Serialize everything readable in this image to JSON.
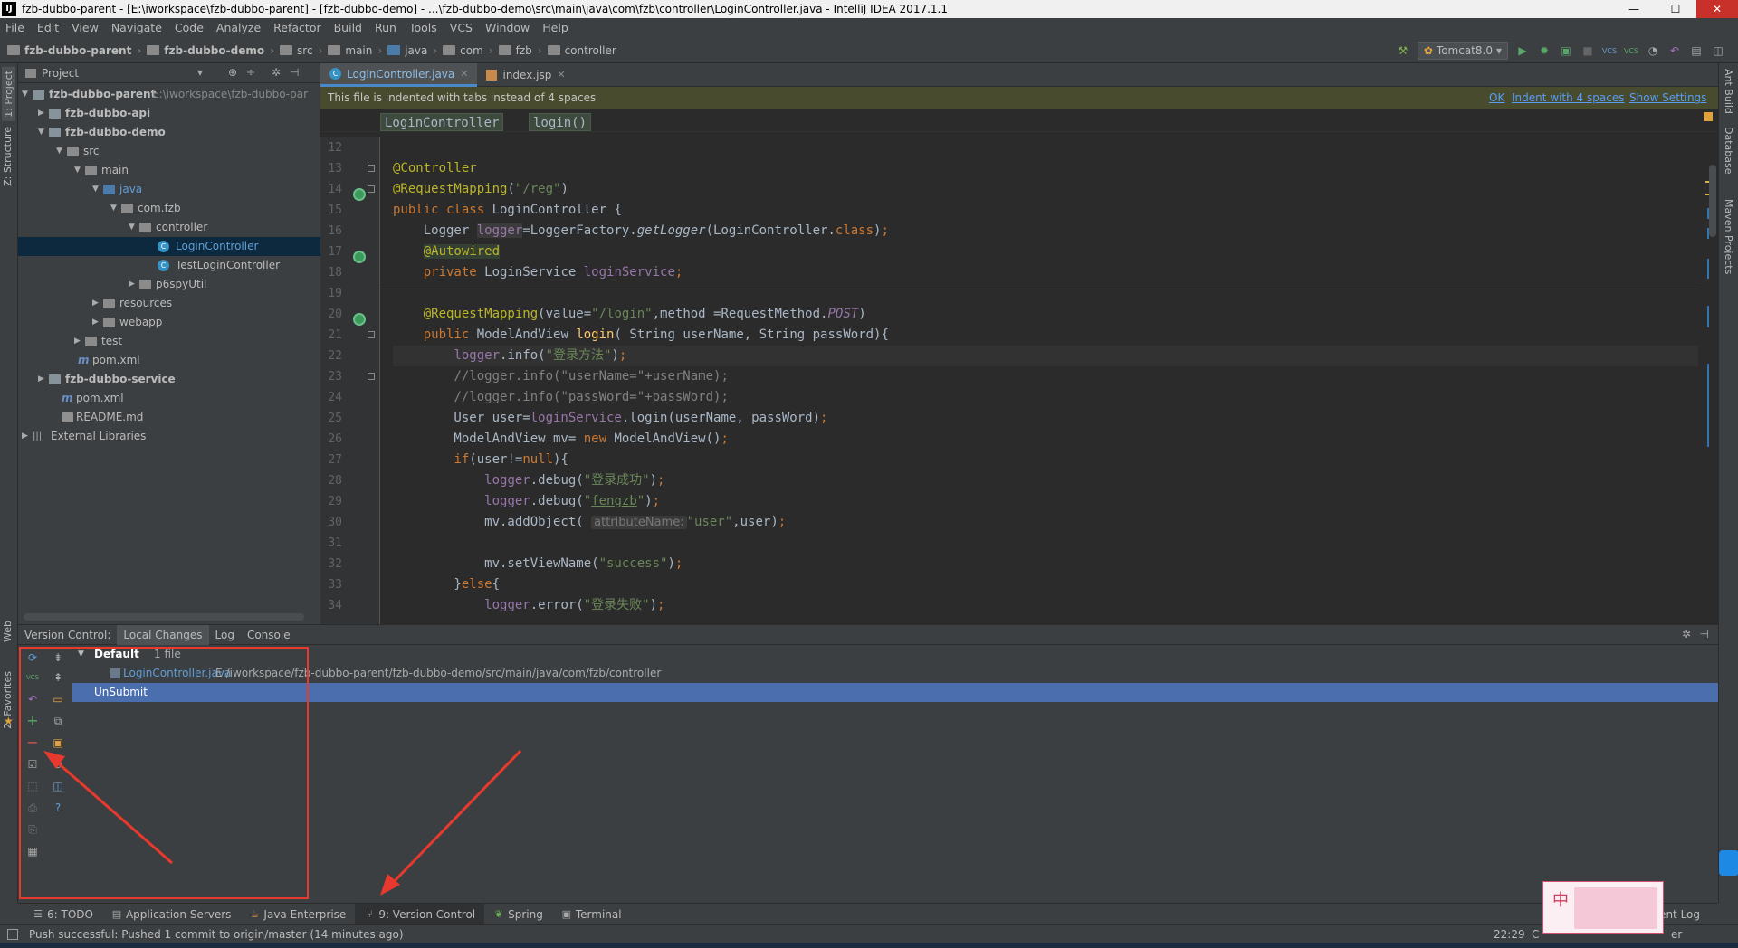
{
  "window": {
    "title": "fzb-dubbo-parent - [E:\\iworkspace\\fzb-dubbo-parent] - [fzb-dubbo-demo] - ...\\fzb-dubbo-demo\\src\\main\\java\\com\\fzb\\controller\\LoginController.java - IntelliJ IDEA 2017.1.1",
    "logo": "IJ",
    "min": "—",
    "max": "☐",
    "close": "✕"
  },
  "menu": [
    "File",
    "Edit",
    "View",
    "Navigate",
    "Code",
    "Analyze",
    "Refactor",
    "Build",
    "Run",
    "Tools",
    "VCS",
    "Window",
    "Help"
  ],
  "breadcrumbs": [
    "fzb-dubbo-parent",
    "fzb-dubbo-demo",
    "src",
    "main",
    "java",
    "com",
    "fzb",
    "controller"
  ],
  "run_config": "Tomcat8.0",
  "left_strip": {
    "project": "1: Project",
    "structure": "Z: Structure",
    "web": "Web",
    "favorites": "2: Favorites"
  },
  "right_strip": {
    "ant": "Ant Build",
    "database": "Database",
    "maven": "Maven Projects"
  },
  "project_panel": {
    "header": "Project",
    "tree": [
      {
        "label": "fzb-dubbo-parent",
        "path": "E:\\iworkspace\\fzb-dubbo-par",
        "bold": true
      },
      {
        "label": "fzb-dubbo-api",
        "bold": true
      },
      {
        "label": "fzb-dubbo-demo",
        "bold": true
      },
      {
        "label": "src"
      },
      {
        "label": "main"
      },
      {
        "label": "java"
      },
      {
        "label": "com.fzb"
      },
      {
        "label": "controller"
      },
      {
        "label": "LoginController"
      },
      {
        "label": "TestLoginController"
      },
      {
        "label": "p6spyUtil"
      },
      {
        "label": "resources"
      },
      {
        "label": "webapp"
      },
      {
        "label": "test"
      },
      {
        "label": "pom.xml"
      },
      {
        "label": "fzb-dubbo-service",
        "bold": true
      },
      {
        "label": "pom.xml"
      },
      {
        "label": "README.md"
      },
      {
        "label": "External Libraries"
      }
    ]
  },
  "editor": {
    "tabs": [
      {
        "label": "LoginController.java",
        "active": true
      },
      {
        "label": "index.jsp",
        "active": false
      }
    ],
    "notification": {
      "text": "This file is indented with tabs instead of 4 spaces",
      "ok": "OK",
      "indent": "Indent with 4 spaces",
      "settings": "Show Settings"
    },
    "code_breadcrumbs": [
      "LoginController",
      "login()"
    ],
    "line_numbers": [
      "12",
      "13",
      "14",
      "15",
      "16",
      "17",
      "18",
      "19",
      "20",
      "21",
      "22",
      "23",
      "24",
      "25",
      "26",
      "27",
      "28",
      "29",
      "30",
      "31",
      "32",
      "33",
      "34"
    ],
    "hint_label": "attributeName:"
  },
  "version_control": {
    "tabs": [
      "Version Control:",
      "Local Changes",
      "Log",
      "Console"
    ],
    "changelist": "Default",
    "changelist_count": "1 file",
    "file": "LoginController.java",
    "file_path": "E:/iworkspace/fzb-dubbo-parent/fzb-dubbo-demo/src/main/java/com/fzb/controller",
    "changelist2": "UnSubmit"
  },
  "bottom_tabs": [
    {
      "label": "6: TODO",
      "icon": "todo-icon"
    },
    {
      "label": "Application Servers",
      "icon": "server-icon"
    },
    {
      "label": "Java Enterprise",
      "icon": "java-ee-icon"
    },
    {
      "label": "9: Version Control",
      "icon": "vcs-icon",
      "active": true
    },
    {
      "label": "Spring",
      "icon": "spring-icon"
    },
    {
      "label": "Terminal",
      "icon": "terminal-icon"
    }
  ],
  "event_log": "Event Log",
  "status": {
    "message": "Push successful: Pushed 1 commit to origin/master (14 minutes ago)",
    "position": "22:29",
    "encoding_hint": "C",
    "vcs_hint": "er"
  },
  "widget": {
    "char": "中"
  },
  "colors": {
    "accent": "#4a88c7",
    "selection": "#4b6eaf",
    "annotation_box": "#e8392e"
  }
}
